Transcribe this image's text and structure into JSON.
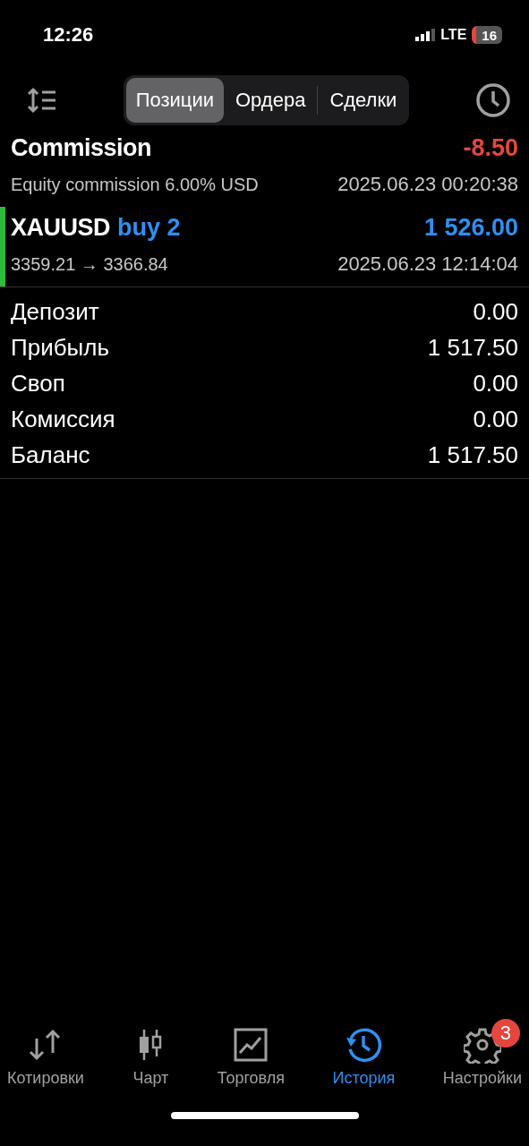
{
  "status_bar": {
    "time": "12:26",
    "network": "LTE",
    "battery": "16"
  },
  "tabs": [
    {
      "label": "Позиции",
      "selected": true
    },
    {
      "label": "Ордера",
      "selected": false
    },
    {
      "label": "Сделки",
      "selected": false
    }
  ],
  "deals": [
    {
      "kind": "commission",
      "title": "Commission",
      "value": "-8.50",
      "color": "#e5463d",
      "subtitle": "Equity commission 6.00% USD",
      "time": "2025.06.23 00:20:38"
    },
    {
      "kind": "trade",
      "title": "XAUUSD",
      "side": "buy 2",
      "value": "1 526.00",
      "color": "#2f8ff0",
      "subtitle": "3359.21 → 3366.84",
      "time": "2025.06.23 12:14:04"
    }
  ],
  "summary": [
    {
      "label": "Депозит",
      "value": "0.00"
    },
    {
      "label": "Прибыль",
      "value": "1 517.50"
    },
    {
      "label": "Своп",
      "value": "0.00"
    },
    {
      "label": "Комиссия",
      "value": "0.00"
    },
    {
      "label": "Баланс",
      "value": "1 517.50"
    }
  ],
  "nav": [
    {
      "kind": "quotes",
      "label": "Котировки",
      "selected": false
    },
    {
      "kind": "chart",
      "label": "Чарт",
      "selected": false
    },
    {
      "kind": "trade",
      "label": "Торговля",
      "selected": false
    },
    {
      "kind": "history",
      "label": "История",
      "selected": true
    },
    {
      "kind": "settings",
      "label": "Настройки",
      "selected": false,
      "badge": "3"
    }
  ]
}
